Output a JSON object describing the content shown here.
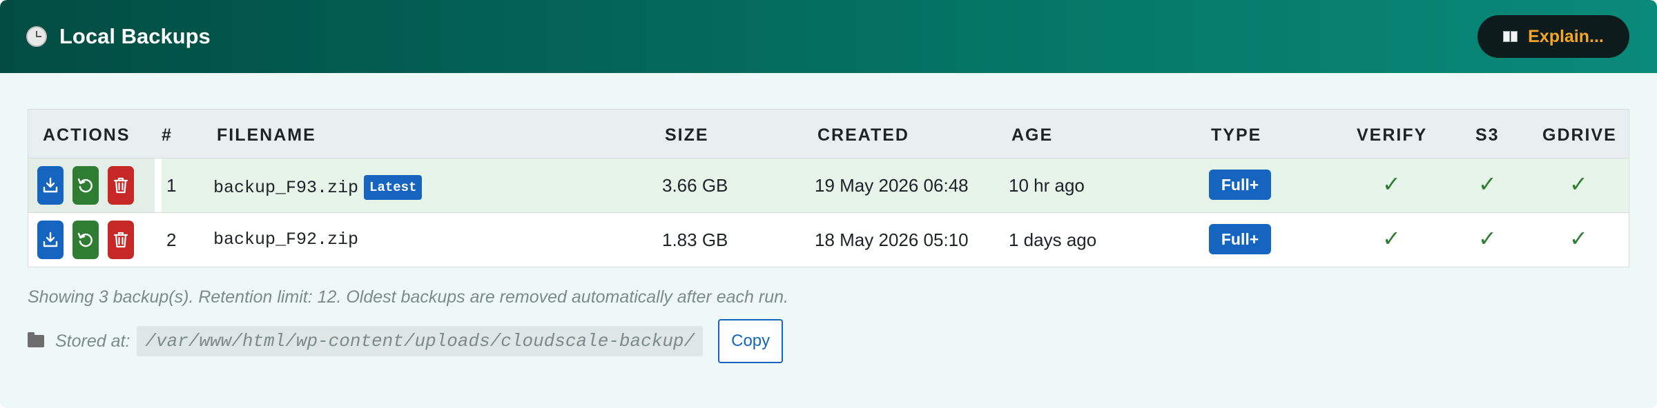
{
  "header": {
    "title": "Local Backups",
    "icon": "clock-icon",
    "explain_label": "Explain...",
    "explain_icon": "book-icon"
  },
  "table": {
    "columns": [
      "ACTIONS",
      "#",
      "FILENAME",
      "SIZE",
      "CREATED",
      "AGE",
      "TYPE",
      "VERIFY",
      "S3",
      "GDRIVE"
    ],
    "rows": [
      {
        "num": "1",
        "filename": "backup_F93.zip",
        "badge": "Latest",
        "size": "3.66 GB",
        "created": "19 May 2026 06:48",
        "age": "10 hr ago",
        "type": "Full+",
        "verify": "✓",
        "s3": "✓",
        "gdrive": "✓"
      },
      {
        "num": "2",
        "filename": "backup_F92.zip",
        "size": "1.83 GB",
        "created": "18 May 2026 05:10",
        "age": "1 days ago",
        "type": "Full+",
        "verify": "✓",
        "s3": "✓",
        "gdrive": "✓"
      }
    ]
  },
  "info_text": "Showing 3 backup(s). Retention limit: 12. Oldest backups are removed automatically after each run.",
  "storage": {
    "label": "Stored at:",
    "path": "/var/www/html/wp-content/uploads/cloudscale-backup/",
    "copy_label": "Copy",
    "icon": "folder-icon"
  },
  "colors": {
    "header_start": "#024c43",
    "header_end": "#0a8a79",
    "accent_blue": "#1565c0",
    "accent_green": "#2e7d32",
    "accent_red": "#c62828",
    "explain_text": "#f5a623"
  }
}
